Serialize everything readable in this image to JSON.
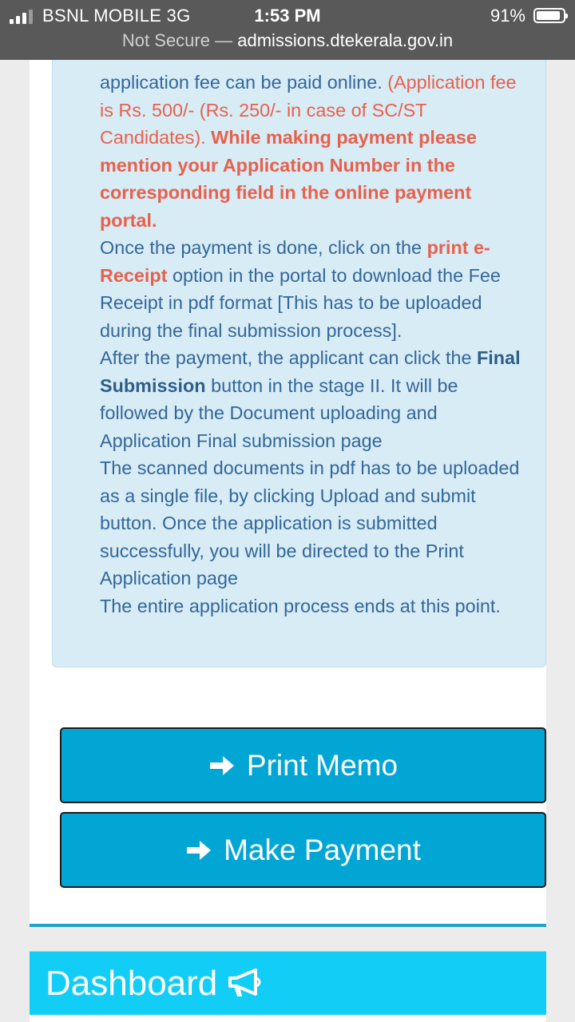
{
  "status_bar": {
    "carrier": "BSNL MOBILE  3G",
    "time": "1:53 PM",
    "battery_percent": "91%",
    "battery_level": 0.91
  },
  "url_bar": {
    "security": "Not Secure",
    "separator": " — ",
    "host": "admissions.dtekerala.gov.in"
  },
  "info": {
    "p1_a": "application fee can be paid online. ",
    "p1_b": "(Application fee is Rs. 500/- (Rs. 250/- in case of SC/ST Candidates). ",
    "p1_c": "While making payment please mention your Application Number in the corresponding field in the online payment portal.",
    "p2_a": "Once the payment is done, click on the ",
    "p2_b": "print e-Receipt",
    "p2_c": " option in the portal to download the Fee Receipt in pdf format [This has to be uploaded during the final submission process].",
    "p3_a": "After the payment, the applicant can click the ",
    "p3_b": "Final Submission",
    "p3_c": " button in the stage II. It will be followed by the Document uploading and Application Final submission page",
    "p4": "The scanned documents in pdf has to be uploaded as a single file, by clicking Upload and submit button. Once the application is submitted successfully, you will be directed to the Print Application page",
    "p5": "The entire application process ends at this point."
  },
  "buttons": {
    "print_memo": "Print Memo",
    "make_payment": "Make Payment",
    "icon": "arrow-right-icon"
  },
  "dashboard": {
    "title": "Dashboard",
    "icon": "bullhorn-icon"
  },
  "colors": {
    "button": "#02a6d5",
    "dashboard": "#12cdf6",
    "info_bg": "#d8ecf6",
    "info_text": "#33679a",
    "highlight": "#e8604c"
  }
}
